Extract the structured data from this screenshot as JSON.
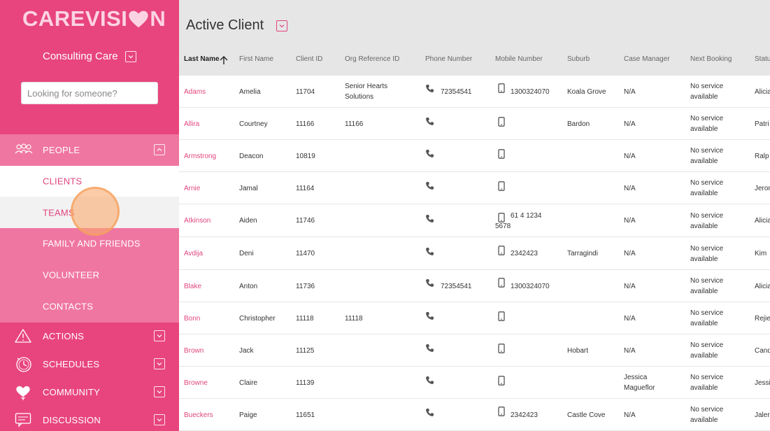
{
  "brand": {
    "logo_prefix": "CAREVISI",
    "logo_suffix": "N",
    "accent": "#e8457e"
  },
  "sidebar": {
    "org": "Consulting Care",
    "search_placeholder": "Looking for someone?",
    "people": {
      "label": "PEOPLE",
      "items": [
        {
          "label": "CLIENTS"
        },
        {
          "label": "TEAMS"
        },
        {
          "label": "FAMILY AND FRIENDS"
        },
        {
          "label": "VOLUNTEER"
        },
        {
          "label": "CONTACTS"
        }
      ]
    },
    "sections": [
      {
        "label": "ACTIONS",
        "icon": "warning-icon"
      },
      {
        "label": "SCHEDULES",
        "icon": "clock-icon"
      },
      {
        "label": "COMMUNITY",
        "icon": "community-heart-icon"
      },
      {
        "label": "DISCUSSION",
        "icon": "chat-icon"
      }
    ]
  },
  "main": {
    "title": "Active Client",
    "columns": [
      "Last Name",
      "First Name",
      "Client ID",
      "Org Reference ID",
      "Phone Number",
      "Mobile Number",
      "Suburb",
      "Case Manager",
      "Next Booking",
      "Status"
    ],
    "rows": [
      {
        "last": "Adams",
        "first": "Amelia",
        "id": "11704",
        "org_ref": "Senior Hearts Solutions",
        "phone": "72354541",
        "mobile": "1300324070",
        "suburb": "Koala Grove",
        "case_manager": "N/A",
        "next_booking": "No service available",
        "status": "Alicia"
      },
      {
        "last": "Allira",
        "first": "Courtney",
        "id": "11166",
        "org_ref": "11166",
        "phone": "",
        "mobile": "",
        "suburb": "Bardon",
        "case_manager": "N/A",
        "next_booking": "No service available",
        "status": "Patri"
      },
      {
        "last": "Armstrong",
        "first": "Deacon",
        "id": "10819",
        "org_ref": "",
        "phone": "",
        "mobile": "",
        "suburb": "",
        "case_manager": "N/A",
        "next_booking": "No service available",
        "status": "Ralp"
      },
      {
        "last": "Arnie",
        "first": "Jamal",
        "id": "11164",
        "org_ref": "",
        "phone": "",
        "mobile": "",
        "suburb": "",
        "case_manager": "N/A",
        "next_booking": "No service available",
        "status": "Jeron"
      },
      {
        "last": "Atkinson",
        "first": "Aiden",
        "id": "11746",
        "org_ref": "",
        "phone": "",
        "mobile": "61 4 1234 5678",
        "suburb": "",
        "case_manager": "N/A",
        "next_booking": "No service available",
        "status": "Alicia"
      },
      {
        "last": "Avdija",
        "first": "Deni",
        "id": "11470",
        "org_ref": "",
        "phone": "",
        "mobile": "2342423",
        "suburb": "Tarragindi",
        "case_manager": "N/A",
        "next_booking": "No service available",
        "status": "Kim"
      },
      {
        "last": "Blake",
        "first": "Anton",
        "id": "11736",
        "org_ref": "",
        "phone": "72354541",
        "mobile": "1300324070",
        "suburb": "",
        "case_manager": "N/A",
        "next_booking": "No service available",
        "status": "Alicia"
      },
      {
        "last": "Bonn",
        "first": "Christopher",
        "id": "11118",
        "org_ref": "11118",
        "phone": "",
        "mobile": "",
        "suburb": "",
        "case_manager": "N/A",
        "next_booking": "No service available",
        "status": "Rejie"
      },
      {
        "last": "Brown",
        "first": "Jack",
        "id": "11125",
        "org_ref": "",
        "phone": "",
        "mobile": "",
        "suburb": "Hobart",
        "case_manager": "N/A",
        "next_booking": "No service available",
        "status": "Cand"
      },
      {
        "last": "Browne",
        "first": "Claire",
        "id": "11139",
        "org_ref": "",
        "phone": "",
        "mobile": "",
        "suburb": "",
        "case_manager": "Jessica Magueflor",
        "next_booking": "No service available",
        "status": "Jessi"
      },
      {
        "last": "Bueckers",
        "first": "Paige",
        "id": "11651",
        "org_ref": "",
        "phone": "",
        "mobile": "2342423",
        "suburb": "Castle Cove",
        "case_manager": "N/A",
        "next_booking": "No service available",
        "status": "Jaler"
      }
    ]
  }
}
